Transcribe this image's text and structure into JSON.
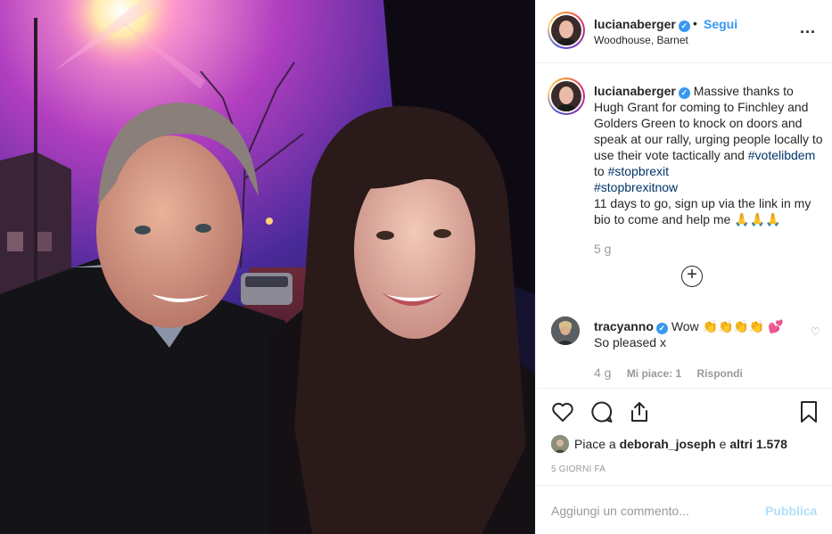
{
  "post": {
    "author": {
      "username": "lucianaberger",
      "verified_icon": "verified-check-icon",
      "follow_label": "Segui",
      "separator": "•",
      "location": "Woodhouse, Barnet",
      "more_label": "..."
    },
    "caption": {
      "username": "lucianaberger",
      "text_before": "Massive thanks to Hugh Grant for coming to Finchley and Golders Green to knock on doors and speak at our rally, urging people locally to use their vote tactically and",
      "hashtag1": "#votelibdem",
      "to_word": "to",
      "hashtag2": "#stopbrexit",
      "hashtag3": "#stopbrexitnow",
      "text_after": "11 days to go, sign up via the link in my bio to come and help me 🙏🙏🙏",
      "time": "5 g"
    },
    "load_more_icon": "plus-circle-icon",
    "comments": [
      {
        "username": "tracyanno",
        "text_line1": "Wow 👏👏👏👏 💕",
        "text_line2": "So pleased x",
        "time": "4 g",
        "likes": "Mi piace: 1",
        "reply_label": "Rispondi"
      }
    ],
    "action_icons": [
      "heart-icon",
      "comment-icon",
      "share-icon",
      "bookmark-icon"
    ],
    "likes": {
      "prefix": "Piace a",
      "user": "deborah_joseph",
      "conjunction": "e",
      "others": "altri 1.578"
    },
    "date": "5 GIORNI FA",
    "add_comment": {
      "placeholder": "Aggiungi un commento...",
      "publish_label": "Pubblica"
    }
  },
  "colors": {
    "link_blue": "#3897f0",
    "hashtag_blue": "#003569",
    "muted_gray": "#999999",
    "publish_disabled": "#b2dffc",
    "border": "#efefef"
  }
}
